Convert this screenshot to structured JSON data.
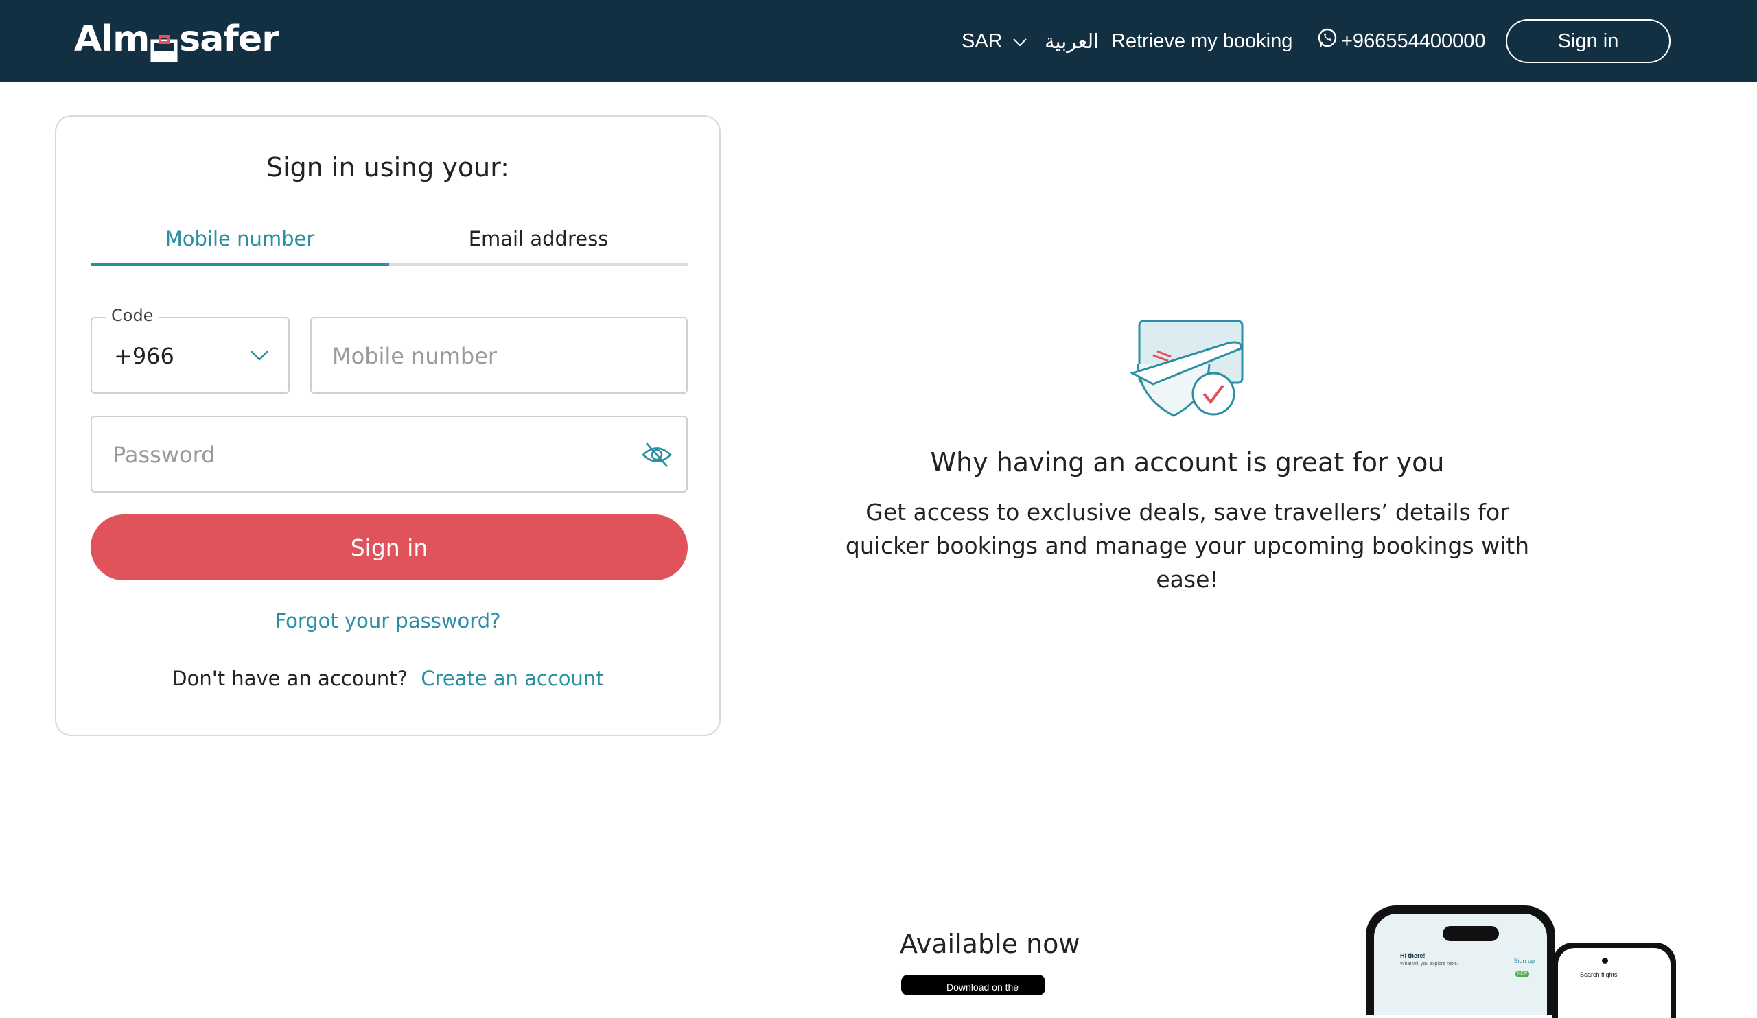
{
  "header": {
    "logo_text_left": "Alm",
    "logo_text_right": "safer",
    "currency": "SAR",
    "language": "العربية",
    "retrieve_booking": "Retrieve my booking",
    "phone": "+966554400000",
    "sign_in": "Sign in"
  },
  "login": {
    "title": "Sign in using your:",
    "tabs": [
      {
        "label": "Mobile number",
        "active": true
      },
      {
        "label": "Email address",
        "active": false
      }
    ],
    "code_label": "Code",
    "code_value": "+966",
    "mobile_placeholder": "Mobile number",
    "password_placeholder": "Password",
    "submit_label": "Sign in",
    "forgot_password": "Forgot your password?",
    "no_account": "Don't have an account?",
    "create_account": "Create an account"
  },
  "benefits": {
    "title": "Why having an account is great for you",
    "text": "Get access to exclusive deals, save travellers’ details for quicker bookings and manage your upcoming bookings with ease!"
  },
  "app_promo": {
    "title": "Available now",
    "store_badge": "Download on the",
    "phone_greeting": "Hi there!",
    "phone_subtitle": "What will you explore next?",
    "phone_signup": "Sign up",
    "phone_new_badge": "NEW",
    "phone2_title": "Search flights"
  },
  "colors": {
    "header_bg": "#132f42",
    "accent": "#2a8fa3",
    "primary_button": "#e0535a"
  }
}
